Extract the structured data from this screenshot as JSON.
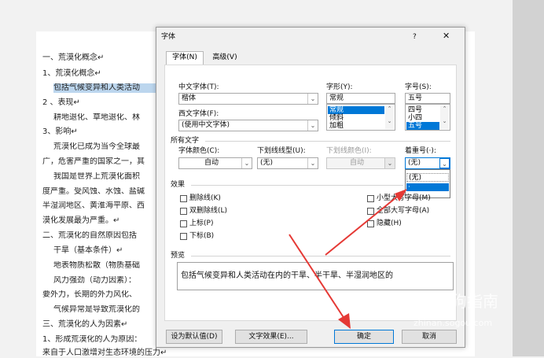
{
  "document": {
    "lines": [
      "一、荒漠化概念↵",
      "1、荒漠化概念↵",
      "包括气候变异和人类活动",
      "2 、表现↵",
      "耕地退化、草地退化、林",
      "3、影响↵",
      "荒漠化已成为当今全球最",
      "广，危害严重的国家之一，其",
      "我国是世界上荒漠化面积",
      "度严重。受风蚀、水蚀、盐碱",
      "半湿润地区、黄淮海平原、西",
      "漠化发展最为严重。↵",
      "二、荒漠化的自然原因包括",
      "干旱（基本条件）↵",
      "地表物质松散（物质基础",
      "风力强劲（动力因素）：",
      "要外力，长期的外力风化、",
      "气候异常是导致荒漠化的",
      "三、荒漠化的人为因素↵",
      "1、形成荒漠化的人为原因：",
      "来自于人口激增对生态环境的压力↵"
    ]
  },
  "dialog": {
    "title": "字体",
    "help": "?",
    "close": "✕",
    "tabs": [
      "字体(N)",
      "高级(V)"
    ],
    "chinese_font_label": "中文字体(T):",
    "chinese_font_value": "楷体",
    "western_font_label": "西文字体(F):",
    "western_font_value": "(使用中文字体)",
    "style_label": "字形(Y):",
    "style_value": "常规",
    "style_options": [
      "常规",
      "倾斜",
      "加粗"
    ],
    "size_label": "字号(S):",
    "size_value": "五号",
    "size_options": [
      "四号",
      "小四",
      "五号"
    ],
    "all_text_label": "所有文字",
    "font_color_label": "字体颜色(C):",
    "font_color_value": "自动",
    "underline_style_label": "下划线线型(U):",
    "underline_style_value": "(无)",
    "underline_color_label": "下划线颜色(I):",
    "underline_color_value": "自动",
    "emphasis_label": "着重号(·):",
    "emphasis_value": "(无)",
    "emphasis_options": [
      "(无)",
      "·"
    ],
    "effects_label": "效果",
    "effects": {
      "strikethrough": "删除线(K)",
      "double_strikethrough": "双删除线(L)",
      "superscript": "上标(P)",
      "subscript": "下标(B)",
      "small_caps": "小型大写字母(M)",
      "all_caps": "全部大写字母(A)",
      "hidden": "隐藏(H)"
    },
    "preview_label": "预览",
    "preview_text": "包括气候变异和人类活动在内的干旱、半干旱、半湿润地区的",
    "set_default": "设为默认值(D)",
    "text_effects": "文字效果(E)...",
    "ok": "确定",
    "cancel": "取消"
  },
  "watermark": {
    "brand": "搜狗指南",
    "url": "zhinan.sogou.com"
  },
  "colors": {
    "selection": "#0078d7",
    "highlight": "#bcd6ee",
    "arrow": "#e53935"
  }
}
